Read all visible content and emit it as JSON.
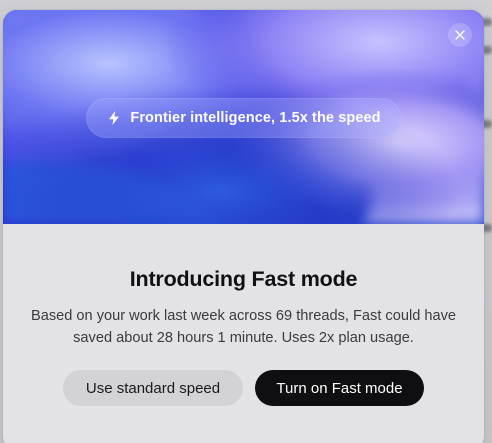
{
  "modal": {
    "pill_text": "Frontier intelligence, 1.5x the speed",
    "title": "Introducing Fast mode",
    "description": "Based on your work last week across 69 threads, Fast could have saved about 28 hours 1 minute. Uses 2x plan usage.",
    "secondary_button": "Use standard speed",
    "primary_button": "Turn on Fast mode",
    "icons": {
      "pill": "bolt-icon",
      "close": "close-icon"
    }
  },
  "colors": {
    "hero_base": "#2b2fd0",
    "primary_button": "#0f0f11",
    "secondary_button": "#d3d3d7",
    "modal_background": "#e3e3e6"
  }
}
